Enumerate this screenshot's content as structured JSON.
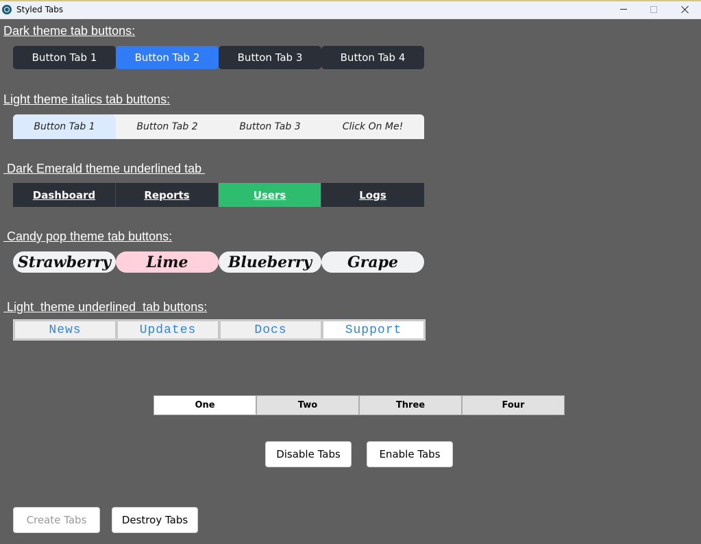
{
  "window": {
    "title": "Styled Tabs"
  },
  "sections": {
    "dark": {
      "heading": "Dark theme tab buttons:",
      "tabs": [
        "Button Tab 1",
        "Button Tab 2",
        "Button Tab 3",
        "Button Tab 4"
      ],
      "active": 1
    },
    "light_italics": {
      "heading": "Light theme italics tab buttons:",
      "tabs": [
        "Button Tab 1",
        "Button Tab 2",
        "Button Tab 3",
        "Click On Me!"
      ],
      "active": 0
    },
    "emerald": {
      "heading": " Dark Emerald theme underlined tab ",
      "tabs": [
        "Dashboard",
        "Reports",
        "Users",
        "Logs"
      ],
      "active": 2
    },
    "candy": {
      "heading": " Candy pop theme tab buttons:",
      "tabs": [
        "Strawberry",
        "Lime",
        "Blueberry",
        "Grape"
      ],
      "active": 1
    },
    "light_underlined": {
      "heading": " Light  theme underlined  tab buttons:",
      "tabs": [
        "News",
        "Updates",
        "Docs",
        "Support"
      ],
      "active": 3
    },
    "plain": {
      "tabs": [
        "One",
        "Two",
        "Three",
        "Four"
      ],
      "active": 0
    }
  },
  "buttons": {
    "disable": "Disable Tabs",
    "enable": "Enable Tabs",
    "create": "Create Tabs",
    "destroy": "Destroy Tabs"
  },
  "colors": {
    "window_bg": "#5f5f5f",
    "dark_tab": "#2b2f37",
    "dark_active": "#2f7cf6",
    "emerald_active": "#2ebd6e",
    "candy_active": "#ffd1dc",
    "light_active": "#dceafd",
    "link_blue": "#2d86de"
  },
  "icons": {
    "app": "app-icon",
    "minimize": "minimize-icon",
    "maximize": "maximize-icon",
    "close": "close-icon"
  }
}
